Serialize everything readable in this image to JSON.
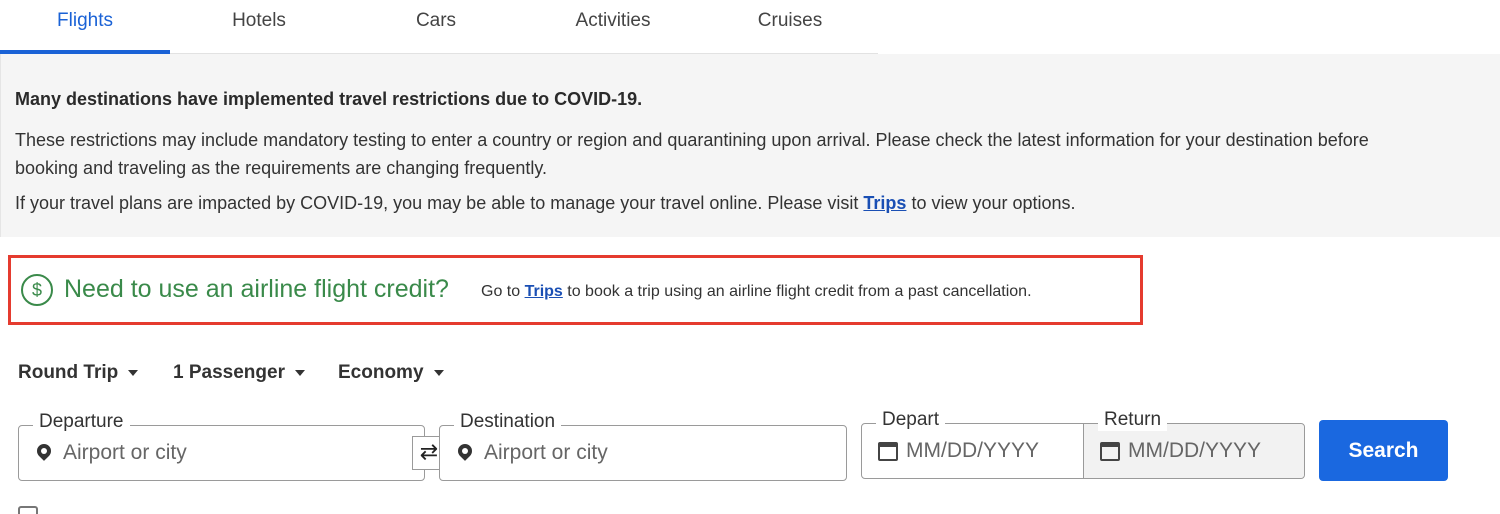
{
  "tabs": [
    {
      "label": "Flights",
      "active": true
    },
    {
      "label": "Hotels",
      "active": false
    },
    {
      "label": "Cars",
      "active": false
    },
    {
      "label": "Activities",
      "active": false
    },
    {
      "label": "Cruises",
      "active": false
    }
  ],
  "notice": {
    "title": "Many destinations have implemented travel restrictions due to COVID-19.",
    "paragraph1": "These restrictions may include mandatory testing to enter a country or region and quarantining upon arrival. Please check the latest information for your destination before booking and traveling as the requirements are changing frequently.",
    "paragraph2_before": "If your travel plans are impacted by COVID-19, you may be able to manage your travel online. Please visit ",
    "paragraph2_link": "Trips",
    "paragraph2_after": " to view your options."
  },
  "credit": {
    "icon": "dollar-circle-icon",
    "heading": "Need to use an airline flight credit?",
    "text_before": "Go to ",
    "link": "Trips",
    "text_after": " to book a trip using an airline flight credit from a past cancellation."
  },
  "options": {
    "trip_type": "Round Trip",
    "passengers": "1 Passenger",
    "cabin": "Economy"
  },
  "form": {
    "departure_label": "Departure",
    "departure_placeholder": "Airport or city",
    "destination_label": "Destination",
    "destination_placeholder": "Airport or city",
    "depart_label": "Depart",
    "depart_placeholder": "MM/DD/YYYY",
    "return_label": "Return",
    "return_placeholder": "MM/DD/YYYY",
    "swap_icon": "⇄",
    "search_label": "Search"
  },
  "colors": {
    "accent": "#1a62d6",
    "credit_green": "#3a8a4a",
    "highlight_red": "#e53b2f",
    "button_blue": "#1a68e0"
  }
}
